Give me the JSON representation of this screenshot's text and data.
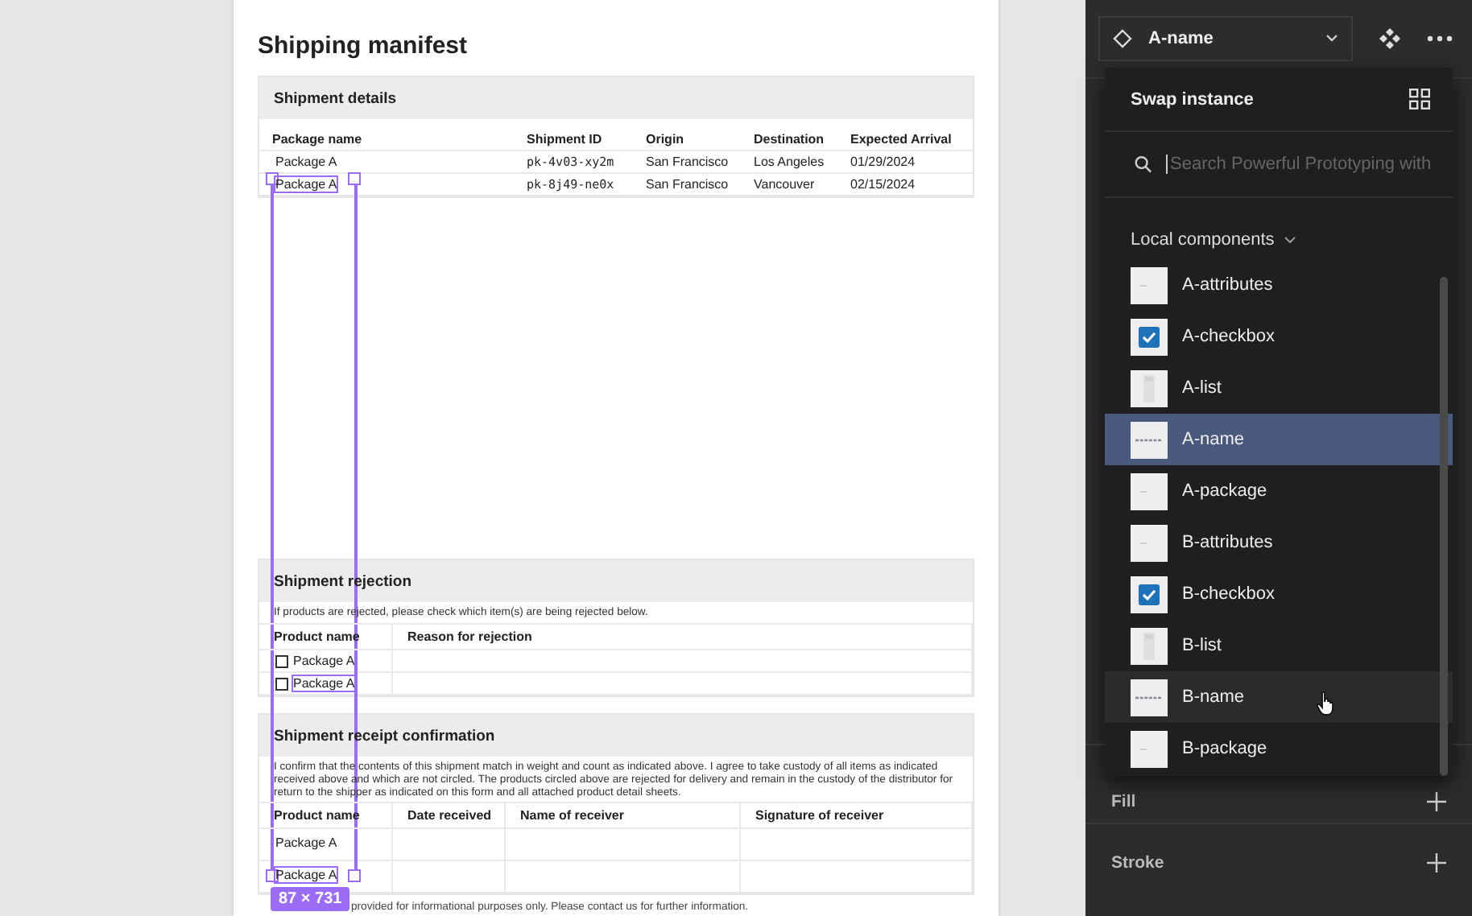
{
  "document": {
    "title": "Shipping manifest",
    "details": {
      "heading": "Shipment details",
      "columns": [
        "Package name",
        "Shipment ID",
        "Origin",
        "Destination",
        "Expected Arrival"
      ],
      "rows": [
        [
          "Package A",
          "pk-4v03-xy2m",
          "San Francisco",
          "Los Angeles",
          "01/29/2024"
        ],
        [
          "Package A",
          "pk-8j49-ne0x",
          "San Francisco",
          "Vancouver",
          "02/15/2024"
        ]
      ]
    },
    "rejection": {
      "heading": "Shipment rejection",
      "note": "If products are rejected, please check which item(s) are being rejected below.",
      "columns": [
        "Product name",
        "Reason for rejection"
      ],
      "rows": [
        {
          "product": "Package A",
          "checked": false
        },
        {
          "product": "Package A",
          "checked": false
        }
      ]
    },
    "confirmation": {
      "heading": "Shipment receipt confirmation",
      "note": "I confirm that the contents of this shipment match in weight and count as indicated above. I agree to take custody of all items as indicated received above and which are not circled. The products circled above are rejected for delivery and remain in the custody of the distributor for return to the shipper as indicated on this form and all attached product detail sheets.",
      "columns": [
        "Product name",
        "Date received",
        "Name of receiver",
        "Signature of receiver"
      ],
      "rows": [
        [
          "Package A"
        ],
        [
          "Package A"
        ]
      ]
    },
    "footer": "provided for informational purposes only. Please contact us for further information."
  },
  "selection": {
    "size": "87 × 731"
  },
  "panel": {
    "instance": "A-name",
    "fill_label": "Fill",
    "stroke_label": "Stroke"
  },
  "swap": {
    "title": "Swap instance",
    "search_placeholder": "Search Powerful Prototyping with",
    "library": "Local components",
    "items": [
      {
        "label": "A-attributes",
        "kind": "blank",
        "selected": false,
        "hovered": false
      },
      {
        "label": "A-checkbox",
        "kind": "checkbox",
        "selected": false,
        "hovered": false
      },
      {
        "label": "A-list",
        "kind": "list",
        "selected": false,
        "hovered": false
      },
      {
        "label": "A-name",
        "kind": "name",
        "selected": true,
        "hovered": false
      },
      {
        "label": "A-package",
        "kind": "blank",
        "selected": false,
        "hovered": false
      },
      {
        "label": "B-attributes",
        "kind": "blank",
        "selected": false,
        "hovered": false
      },
      {
        "label": "B-checkbox",
        "kind": "checkbox",
        "selected": false,
        "hovered": false
      },
      {
        "label": "B-list",
        "kind": "list",
        "selected": false,
        "hovered": false
      },
      {
        "label": "B-name",
        "kind": "name",
        "selected": false,
        "hovered": true
      },
      {
        "label": "B-package",
        "kind": "blank",
        "selected": false,
        "hovered": false
      }
    ]
  }
}
